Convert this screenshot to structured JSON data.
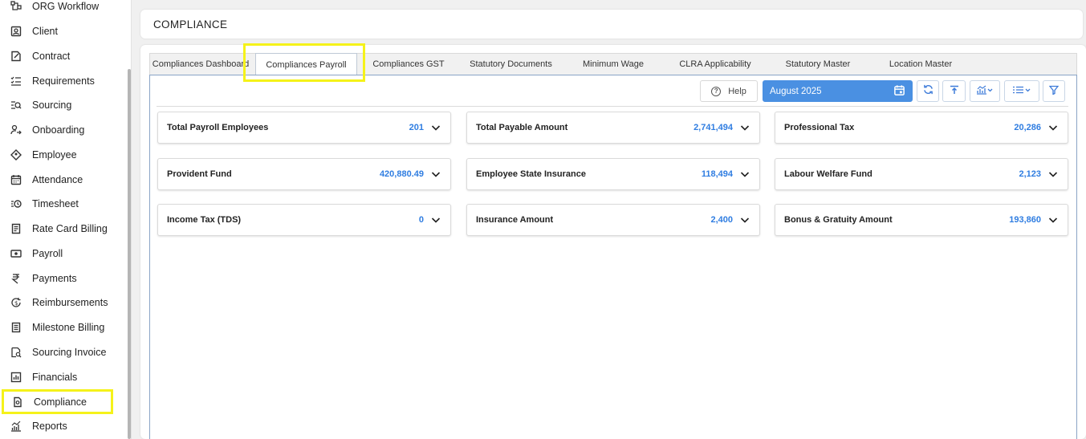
{
  "sidebar": {
    "items": [
      {
        "label": "ORG Workflow",
        "icon": "workflow-icon"
      },
      {
        "label": "Client",
        "icon": "client-icon"
      },
      {
        "label": "Contract",
        "icon": "contract-icon"
      },
      {
        "label": "Requirements",
        "icon": "requirements-icon"
      },
      {
        "label": "Sourcing",
        "icon": "sourcing-icon"
      },
      {
        "label": "Onboarding",
        "icon": "onboarding-icon"
      },
      {
        "label": "Employee",
        "icon": "employee-icon"
      },
      {
        "label": "Attendance",
        "icon": "calendar-icon"
      },
      {
        "label": "Timesheet",
        "icon": "timesheet-icon"
      },
      {
        "label": "Rate Card Billing",
        "icon": "rate-card-icon"
      },
      {
        "label": "Payroll",
        "icon": "payroll-icon"
      },
      {
        "label": "Payments",
        "icon": "rupee-icon"
      },
      {
        "label": "Reimbursements",
        "icon": "reimbursement-icon"
      },
      {
        "label": "Milestone Billing",
        "icon": "milestone-icon"
      },
      {
        "label": "Sourcing Invoice",
        "icon": "invoice-icon"
      },
      {
        "label": "Financials",
        "icon": "financials-icon"
      },
      {
        "label": "Compliance",
        "icon": "compliance-icon",
        "active": true
      },
      {
        "label": "Reports",
        "icon": "reports-icon"
      }
    ]
  },
  "header": {
    "title": "COMPLIANCE"
  },
  "tabs": [
    {
      "label": "Compliances Dashboard"
    },
    {
      "label": "Compliances Payroll",
      "active": true
    },
    {
      "label": "Compliances GST"
    },
    {
      "label": "Statutory Documents"
    },
    {
      "label": "Minimum Wage"
    },
    {
      "label": "CLRA Applicability"
    },
    {
      "label": "Statutory Master"
    },
    {
      "label": "Location Master"
    }
  ],
  "toolbar": {
    "help_label": "Help",
    "period": "August 2025",
    "icons": [
      "refresh-icon",
      "upload-icon",
      "chart-icon",
      "list-icon",
      "filter-icon"
    ]
  },
  "cards": [
    {
      "label": "Total Payroll Employees",
      "value": "201"
    },
    {
      "label": "Total Payable Amount",
      "value": "2,741,494"
    },
    {
      "label": "Professional Tax",
      "value": "20,286"
    },
    {
      "label": "Provident Fund",
      "value": "420,880.49"
    },
    {
      "label": "Employee State Insurance",
      "value": "118,494"
    },
    {
      "label": "Labour Welfare Fund",
      "value": "2,123"
    },
    {
      "label": "Income Tax (TDS)",
      "value": "0"
    },
    {
      "label": "Insurance Amount",
      "value": "2,400"
    },
    {
      "label": "Bonus & Gratuity Amount",
      "value": "193,860"
    }
  ],
  "colors": {
    "accent": "#4a90e2",
    "value": "#2f7de1",
    "highlight": "#f5f21a"
  }
}
